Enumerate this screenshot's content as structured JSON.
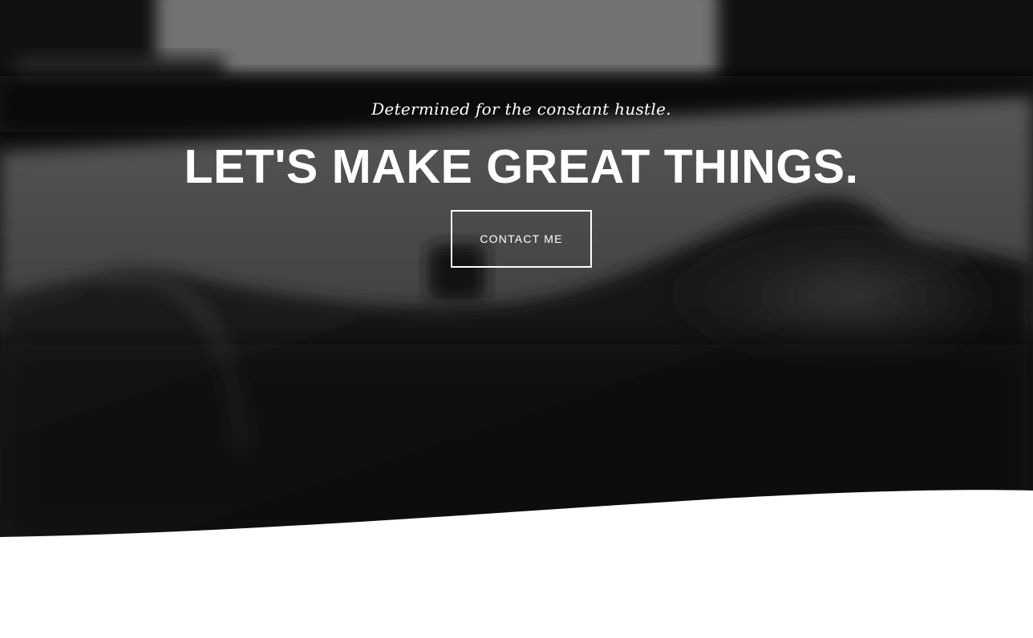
{
  "hero": {
    "tagline": "Determined for the constant hustle.",
    "headline": "LET'S MAKE GREAT THINGS.",
    "cta_label": "CONTACT ME"
  },
  "colors": {
    "hero_overlay": "#141414",
    "text": "#ffffff",
    "page_background": "#ffffff"
  }
}
